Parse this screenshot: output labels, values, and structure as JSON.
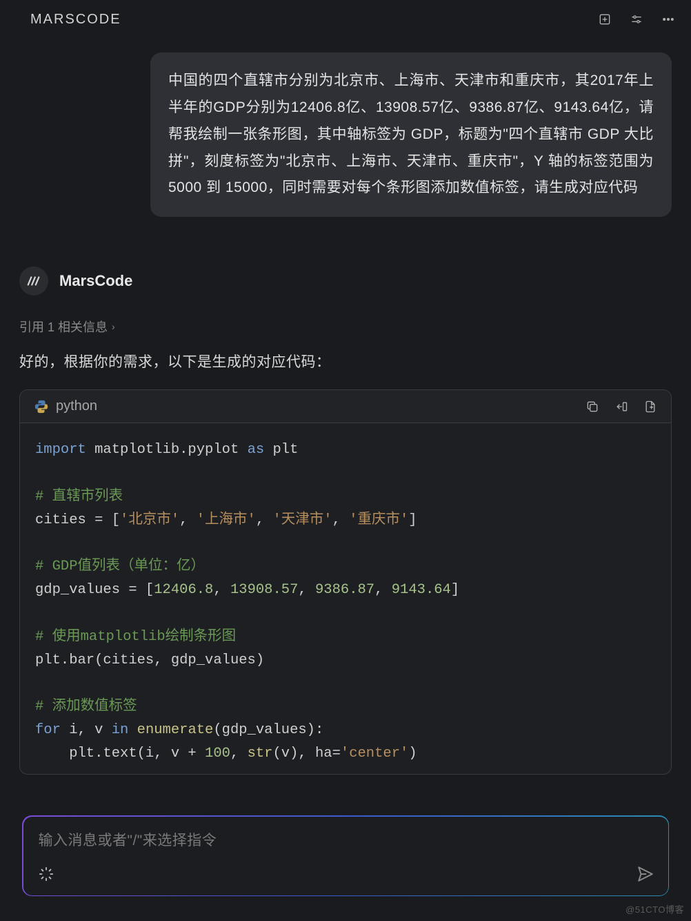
{
  "header": {
    "title": "MARSCODE"
  },
  "user_message": "中国的四个直辖市分别为北京市、上海市、天津市和重庆市，其2017年上半年的GDP分别为12406.8亿、13908.57亿、9386.87亿、9143.64亿，请帮我绘制一张条形图，其中轴标签为 GDP，标题为\"四个直辖市 GDP 大比拼\"，刻度标签为\"北京市、上海市、天津市、重庆市\"，Y 轴的标签范围为 5000 到 15000，同时需要对每个条形图添加数值标签，请生成对应代码",
  "assistant": {
    "name": "MarsCode",
    "reference_text": "引用 1 相关信息",
    "intro": "好的，根据你的需求，以下是生成的对应代码：",
    "code": {
      "language": "python",
      "lines": {
        "l1a": "import",
        "l1b": " matplotlib.pyplot ",
        "l1c": "as",
        "l1d": " plt",
        "c1": "# 直辖市列表",
        "l2a": "cities = [",
        "l2b": "'北京市'",
        "l2c": ", ",
        "l2d": "'上海市'",
        "l2e": ", ",
        "l2f": "'天津市'",
        "l2g": ", ",
        "l2h": "'重庆市'",
        "l2i": "]",
        "c2": "# GDP值列表（单位：亿）",
        "l3a": "gdp_values = [",
        "l3b": "12406.8",
        "l3c": ", ",
        "l3d": "13908.57",
        "l3e": ", ",
        "l3f": "9386.87",
        "l3g": ", ",
        "l3h": "9143.64",
        "l3i": "]",
        "c3": "# 使用matplotlib绘制条形图",
        "l4": "plt.bar(cities, gdp_values)",
        "c4": "# 添加数值标签",
        "l5a": "for",
        "l5b": " i, v ",
        "l5c": "in",
        "l5d": " ",
        "l5e": "enumerate",
        "l5f": "(gdp_values):",
        "l6a": "    plt.text(i, v + ",
        "l6b": "100",
        "l6c": ", ",
        "l6d": "str",
        "l6e": "(v), ha=",
        "l6f": "'center'",
        "l6g": ")"
      }
    }
  },
  "input": {
    "placeholder": "输入消息或者\"/\"来选择指令"
  },
  "watermark": "@51CTO博客",
  "chart_data": {
    "type": "bar",
    "title": "四个直辖市 GDP 大比拼",
    "categories": [
      "北京市",
      "上海市",
      "天津市",
      "重庆市"
    ],
    "values": [
      12406.8,
      13908.57,
      9386.87,
      9143.64
    ],
    "ylabel": "GDP",
    "ylim": [
      5000,
      15000
    ]
  }
}
